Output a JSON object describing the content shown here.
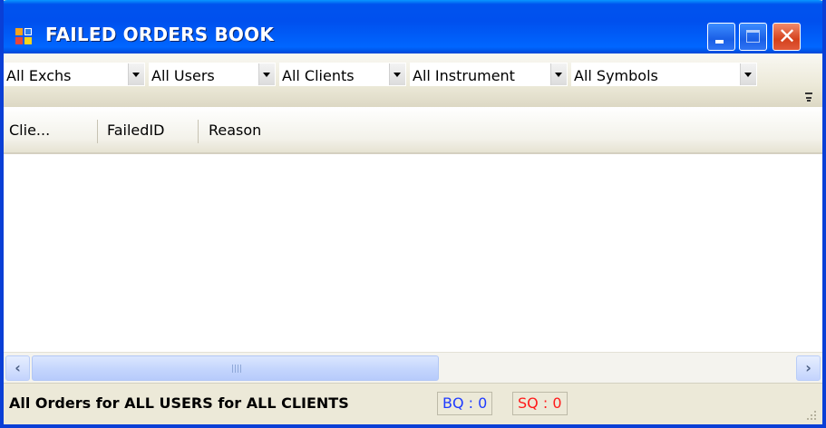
{
  "window": {
    "title": "FAILED ORDERS BOOK",
    "controls": {
      "minimize": "minimize",
      "maximize": "maximize",
      "close": "close"
    }
  },
  "filters": [
    {
      "name": "exchange",
      "value": "All Exchs"
    },
    {
      "name": "users",
      "value": "All Users"
    },
    {
      "name": "clients",
      "value": "All Clients"
    },
    {
      "name": "instrument",
      "value": "All Instrument"
    },
    {
      "name": "symbols",
      "value": "All Symbols"
    }
  ],
  "grid": {
    "columns": [
      "Clie...",
      "FailedID",
      "Reason"
    ],
    "rows": []
  },
  "status": {
    "text": "All Orders for ALL USERS for ALL CLIENTS",
    "bq": "BQ : 0",
    "sq": "SQ : 0",
    "bq_color": "#1f3bff",
    "sq_color": "#ff1a1a"
  },
  "theme": {
    "titlebar_blue": "#0050EE",
    "window_face": "#ECE9D8"
  }
}
